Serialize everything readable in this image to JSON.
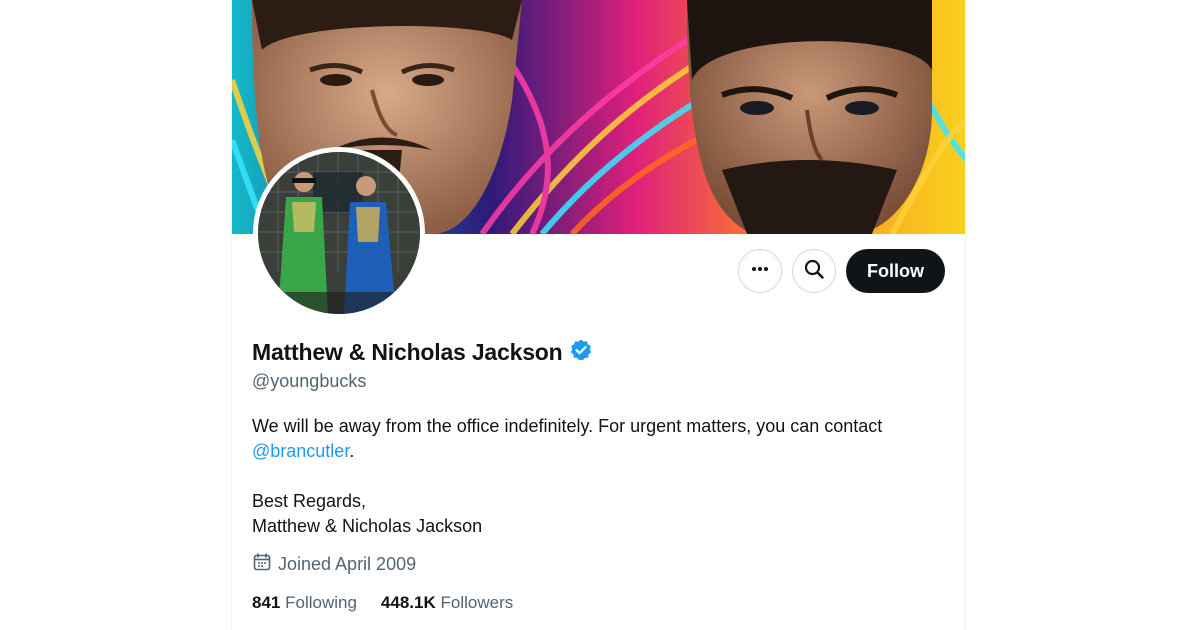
{
  "profile": {
    "display_name": "Matthew & Nicholas Jackson",
    "handle": "@youngbucks",
    "bio_line1": "We will be away from the office indefinitely. For urgent matters, you can contact",
    "bio_mention": "@brancutler",
    "bio_period": ".",
    "bio_closing": "Best Regards,",
    "bio_signature": "Matthew & Nicholas Jackson",
    "joined": "Joined April 2009",
    "following_count": "841",
    "following_label": "Following",
    "followers_count": "448.1K",
    "followers_label": "Followers"
  },
  "actions": {
    "more_icon": "more-horizontal-icon",
    "search_icon": "search-icon",
    "follow_label": "Follow"
  },
  "colors": {
    "accent": "#1d9bf0",
    "text": "#0f1419",
    "muted": "#536471",
    "follow_bg": "#0f1419",
    "border": "#cfd9de"
  }
}
